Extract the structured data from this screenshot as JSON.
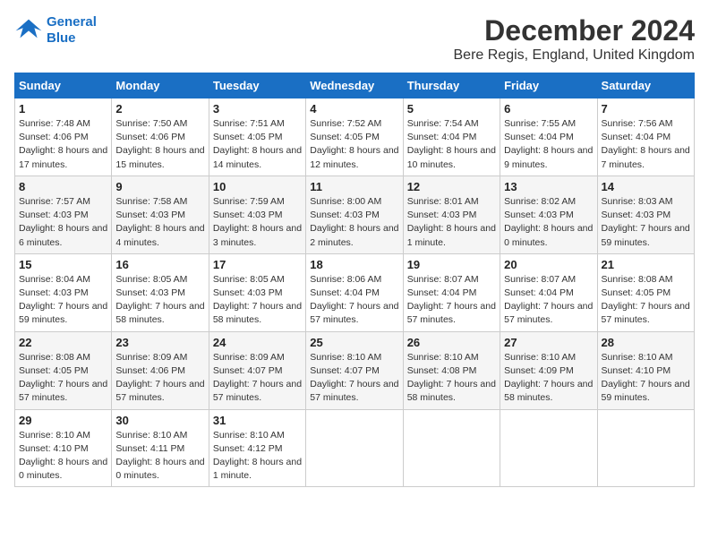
{
  "header": {
    "logo_line1": "General",
    "logo_line2": "Blue",
    "month_title": "December 2024",
    "location": "Bere Regis, England, United Kingdom"
  },
  "days_of_week": [
    "Sunday",
    "Monday",
    "Tuesday",
    "Wednesday",
    "Thursday",
    "Friday",
    "Saturday"
  ],
  "weeks": [
    [
      {
        "day": "1",
        "info": "Sunrise: 7:48 AM\nSunset: 4:06 PM\nDaylight: 8 hours and 17 minutes."
      },
      {
        "day": "2",
        "info": "Sunrise: 7:50 AM\nSunset: 4:06 PM\nDaylight: 8 hours and 15 minutes."
      },
      {
        "day": "3",
        "info": "Sunrise: 7:51 AM\nSunset: 4:05 PM\nDaylight: 8 hours and 14 minutes."
      },
      {
        "day": "4",
        "info": "Sunrise: 7:52 AM\nSunset: 4:05 PM\nDaylight: 8 hours and 12 minutes."
      },
      {
        "day": "5",
        "info": "Sunrise: 7:54 AM\nSunset: 4:04 PM\nDaylight: 8 hours and 10 minutes."
      },
      {
        "day": "6",
        "info": "Sunrise: 7:55 AM\nSunset: 4:04 PM\nDaylight: 8 hours and 9 minutes."
      },
      {
        "day": "7",
        "info": "Sunrise: 7:56 AM\nSunset: 4:04 PM\nDaylight: 8 hours and 7 minutes."
      }
    ],
    [
      {
        "day": "8",
        "info": "Sunrise: 7:57 AM\nSunset: 4:03 PM\nDaylight: 8 hours and 6 minutes."
      },
      {
        "day": "9",
        "info": "Sunrise: 7:58 AM\nSunset: 4:03 PM\nDaylight: 8 hours and 4 minutes."
      },
      {
        "day": "10",
        "info": "Sunrise: 7:59 AM\nSunset: 4:03 PM\nDaylight: 8 hours and 3 minutes."
      },
      {
        "day": "11",
        "info": "Sunrise: 8:00 AM\nSunset: 4:03 PM\nDaylight: 8 hours and 2 minutes."
      },
      {
        "day": "12",
        "info": "Sunrise: 8:01 AM\nSunset: 4:03 PM\nDaylight: 8 hours and 1 minute."
      },
      {
        "day": "13",
        "info": "Sunrise: 8:02 AM\nSunset: 4:03 PM\nDaylight: 8 hours and 0 minutes."
      },
      {
        "day": "14",
        "info": "Sunrise: 8:03 AM\nSunset: 4:03 PM\nDaylight: 7 hours and 59 minutes."
      }
    ],
    [
      {
        "day": "15",
        "info": "Sunrise: 8:04 AM\nSunset: 4:03 PM\nDaylight: 7 hours and 59 minutes."
      },
      {
        "day": "16",
        "info": "Sunrise: 8:05 AM\nSunset: 4:03 PM\nDaylight: 7 hours and 58 minutes."
      },
      {
        "day": "17",
        "info": "Sunrise: 8:05 AM\nSunset: 4:03 PM\nDaylight: 7 hours and 58 minutes."
      },
      {
        "day": "18",
        "info": "Sunrise: 8:06 AM\nSunset: 4:04 PM\nDaylight: 7 hours and 57 minutes."
      },
      {
        "day": "19",
        "info": "Sunrise: 8:07 AM\nSunset: 4:04 PM\nDaylight: 7 hours and 57 minutes."
      },
      {
        "day": "20",
        "info": "Sunrise: 8:07 AM\nSunset: 4:04 PM\nDaylight: 7 hours and 57 minutes."
      },
      {
        "day": "21",
        "info": "Sunrise: 8:08 AM\nSunset: 4:05 PM\nDaylight: 7 hours and 57 minutes."
      }
    ],
    [
      {
        "day": "22",
        "info": "Sunrise: 8:08 AM\nSunset: 4:05 PM\nDaylight: 7 hours and 57 minutes."
      },
      {
        "day": "23",
        "info": "Sunrise: 8:09 AM\nSunset: 4:06 PM\nDaylight: 7 hours and 57 minutes."
      },
      {
        "day": "24",
        "info": "Sunrise: 8:09 AM\nSunset: 4:07 PM\nDaylight: 7 hours and 57 minutes."
      },
      {
        "day": "25",
        "info": "Sunrise: 8:10 AM\nSunset: 4:07 PM\nDaylight: 7 hours and 57 minutes."
      },
      {
        "day": "26",
        "info": "Sunrise: 8:10 AM\nSunset: 4:08 PM\nDaylight: 7 hours and 58 minutes."
      },
      {
        "day": "27",
        "info": "Sunrise: 8:10 AM\nSunset: 4:09 PM\nDaylight: 7 hours and 58 minutes."
      },
      {
        "day": "28",
        "info": "Sunrise: 8:10 AM\nSunset: 4:10 PM\nDaylight: 7 hours and 59 minutes."
      }
    ],
    [
      {
        "day": "29",
        "info": "Sunrise: 8:10 AM\nSunset: 4:10 PM\nDaylight: 8 hours and 0 minutes."
      },
      {
        "day": "30",
        "info": "Sunrise: 8:10 AM\nSunset: 4:11 PM\nDaylight: 8 hours and 0 minutes."
      },
      {
        "day": "31",
        "info": "Sunrise: 8:10 AM\nSunset: 4:12 PM\nDaylight: 8 hours and 1 minute."
      },
      null,
      null,
      null,
      null
    ]
  ]
}
